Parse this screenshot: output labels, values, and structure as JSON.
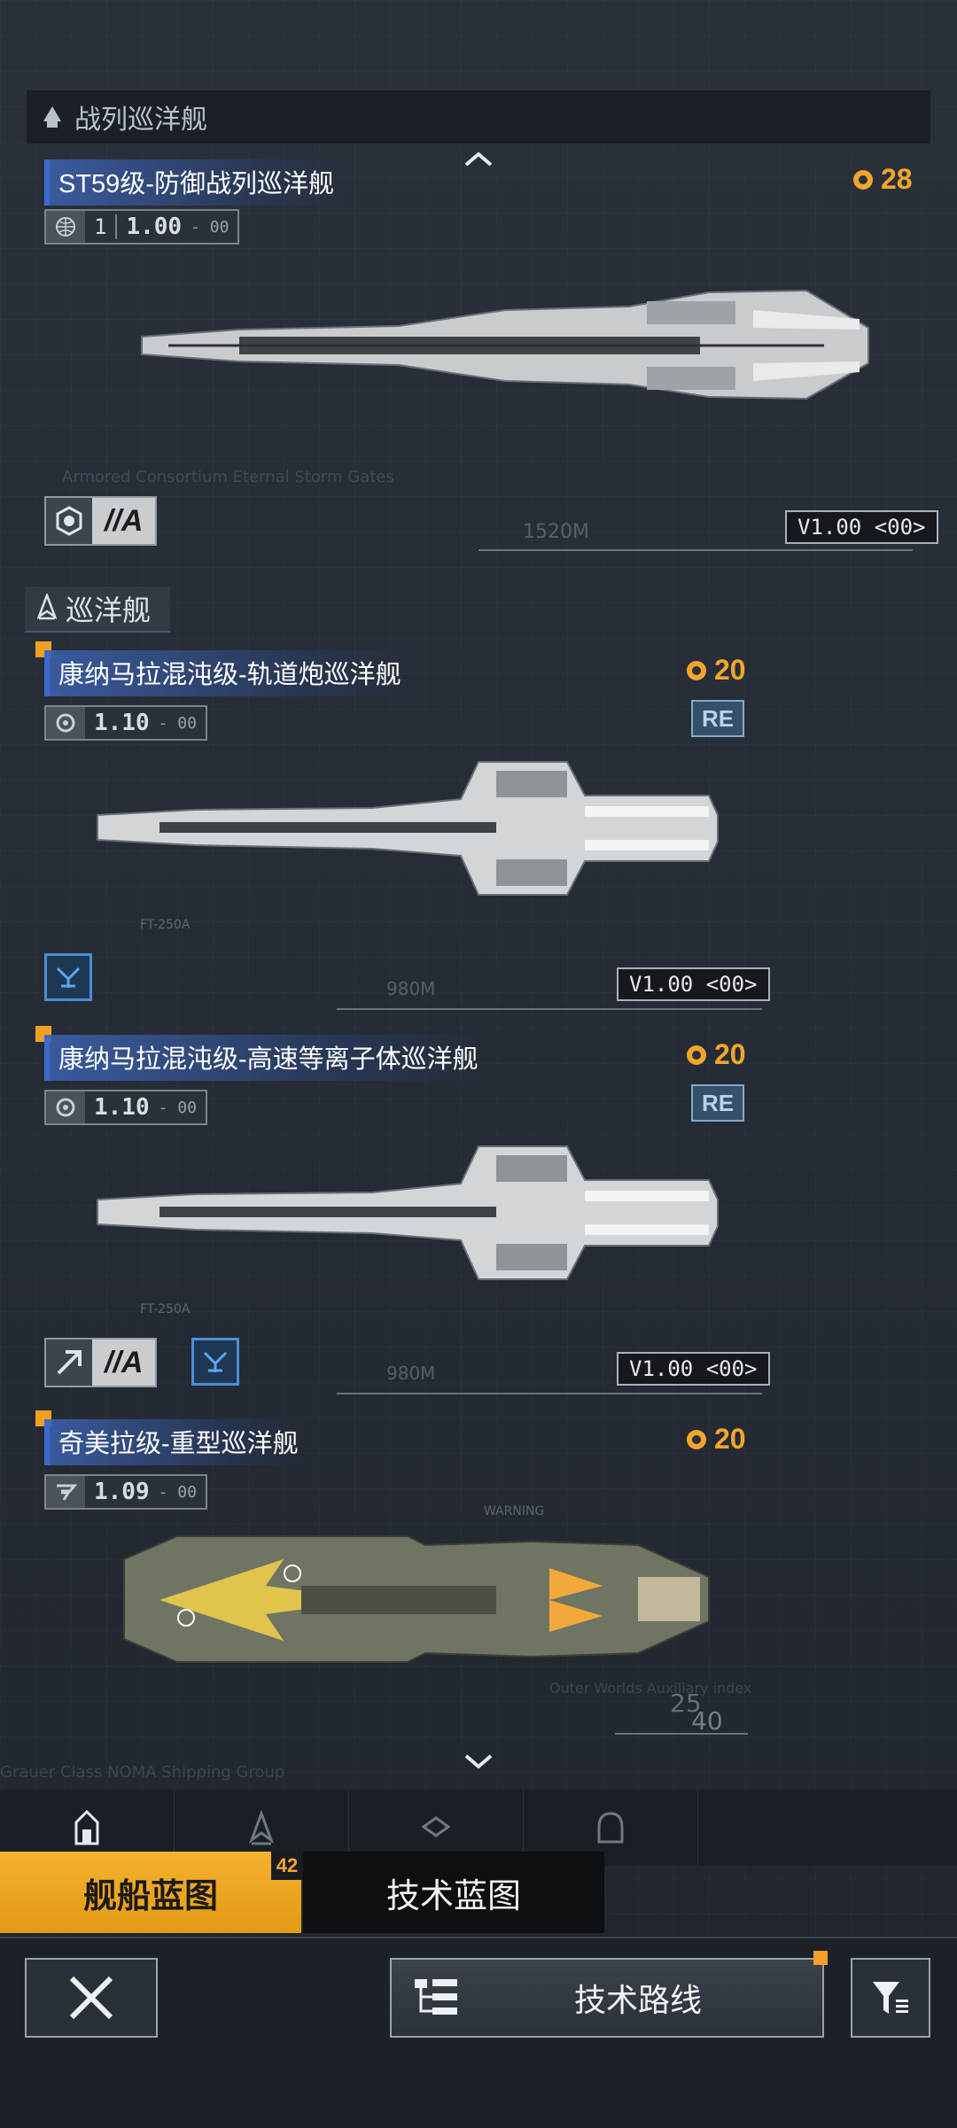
{
  "sections": [
    {
      "label": "战列巡洋舰",
      "icon": "battlecruiser-class-icon"
    },
    {
      "label": "巡洋舰",
      "icon": "cruiser-class-icon"
    }
  ],
  "ships": [
    {
      "name": "ST59级-防御战列巡洋舰",
      "version_prefix": "1",
      "version": "1.00",
      "version_suffix": "- 00",
      "cost": "28",
      "code": "V1.00 <00>",
      "grade": "//A",
      "length_label": "1520M"
    },
    {
      "name": "康纳马拉混沌级-轨道炮巡洋舰",
      "version": "1.10",
      "version_suffix": "- 00",
      "cost": "20",
      "badge": "RE",
      "code": "V1.00 <00>",
      "length_label": "980M",
      "weapon_label": "FT-250A"
    },
    {
      "name": "康纳马拉混沌级-高速等离子体巡洋舰",
      "version": "1.10",
      "version_suffix": "- 00",
      "cost": "20",
      "badge": "RE",
      "code": "V1.00 <00>",
      "grade": "//A",
      "length_label": "980M",
      "weapon_label": "FT-250A"
    },
    {
      "name": "奇美拉级-重型巡洋舰",
      "version": "1.09",
      "version_suffix": "- 00",
      "cost": "20",
      "warning_label": "WARNING",
      "scale_a": "25",
      "scale_b": "40"
    }
  ],
  "tabs": {
    "ship_blueprint": "舰船蓝图",
    "ship_blueprint_count": "42",
    "tech_blueprint": "技术蓝图"
  },
  "footer": {
    "tech_route": "技术路线"
  },
  "colors": {
    "accent": "#f2a62a",
    "title_blue": "#3a6ad0",
    "re_badge": "#35506a"
  }
}
